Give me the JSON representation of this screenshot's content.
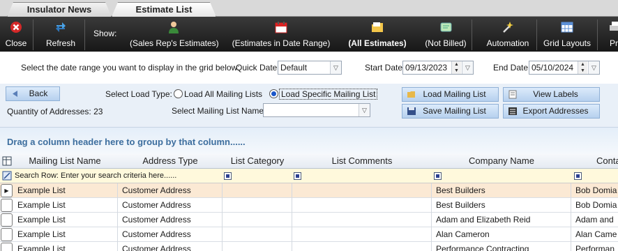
{
  "tabs": [
    {
      "label": "Insulator News"
    },
    {
      "label": "Estimate List"
    }
  ],
  "toolbar": {
    "close_label": "Close",
    "refresh_label": "Refresh",
    "show_label": "Show:",
    "sales_rep_label": "(Sales Rep's Estimates)",
    "date_range_label": "(Estimates in Date Range)",
    "all_estimates_label": "(All Estimates)",
    "not_billed_label": "(Not Billed)",
    "automation_label": "Automation",
    "grid_layouts_label": "Grid Layouts",
    "print_label": "Pr"
  },
  "daterow": {
    "instructions": "Select the date range you want to display in the grid below:",
    "quick_date_label": "Quick Date:",
    "quick_date_value": "Default",
    "start_date_label": "Start Date:",
    "start_date_value": "09/13/2023",
    "end_date_label": "End Date:",
    "end_date_value": "05/10/2024"
  },
  "load": {
    "back_label": "Back",
    "quantity_text": "Quantity of Addresses: 23",
    "select_load_type_label": "Select Load Type:",
    "option_all": "Load All Mailing Lists",
    "option_specific": "Load Specific Mailing List",
    "select_name_label": "Select Mailing List Name:",
    "list_name_value": "",
    "load_mailing_list_label": "Load Mailing List",
    "save_mailing_list_label": "Save Mailing List",
    "view_labels_label": "View Labels",
    "export_addresses_label": "Export Addresses"
  },
  "grid": {
    "group_hint": "Drag a column header here to group by that column......",
    "columns": [
      "Mailing List Name",
      "Address Type",
      "List Category",
      "List Comments",
      "Company Name",
      "Conta"
    ],
    "search_row_text": "Search Row: Enter your search criteria here......",
    "rows": [
      {
        "list": "Example List",
        "type": "Customer Address",
        "category": "",
        "comments": "",
        "company": "Best Builders",
        "contact": "Bob Domia"
      },
      {
        "list": "Example List",
        "type": "Customer Address",
        "category": "",
        "comments": "",
        "company": "Best Builders",
        "contact": "Bob Domia"
      },
      {
        "list": "Example List",
        "type": "Customer Address",
        "category": "",
        "comments": "",
        "company": "Adam and Elizabeth Reid",
        "contact": "Adam and"
      },
      {
        "list": "Example List",
        "type": "Customer Address",
        "category": "",
        "comments": "",
        "company": "Alan Cameron",
        "contact": "Alan Came"
      },
      {
        "list": "Example List",
        "type": "Customer Address",
        "category": "",
        "comments": "",
        "company": "Performance Contracting",
        "contact": "Performan"
      }
    ]
  },
  "colors": {
    "toolbar": "#1e1e1e",
    "accent": "#3d6e9e",
    "selected_row": "#fbe9d4"
  }
}
